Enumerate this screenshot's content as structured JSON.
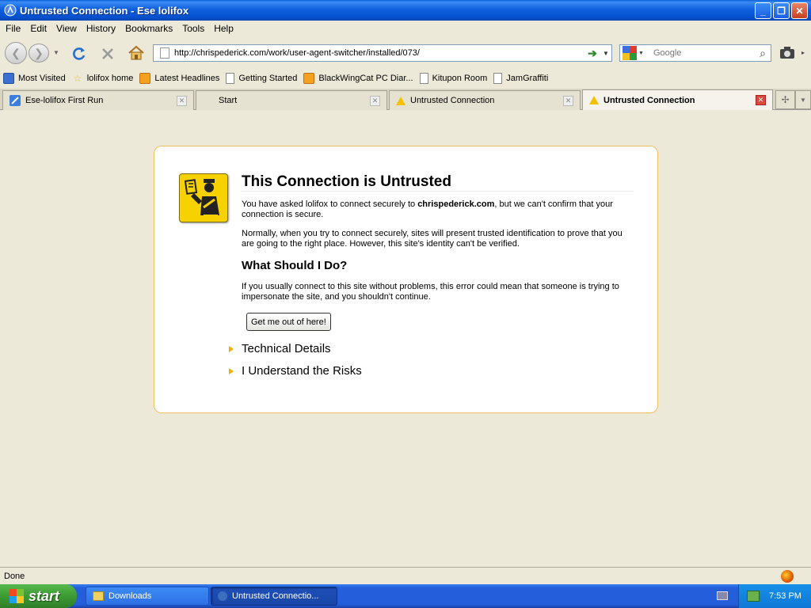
{
  "window": {
    "title": "Untrusted Connection - Ese lolifox",
    "min_symbol": "_",
    "max_symbol": "❐",
    "close_symbol": "✕"
  },
  "menu": [
    "File",
    "Edit",
    "View",
    "History",
    "Bookmarks",
    "Tools",
    "Help"
  ],
  "navbar": {
    "url": "http://chrispederick.com/work/user-agent-switcher/installed/073/",
    "search_placeholder": "Google",
    "icons": [
      "back-icon",
      "forward-icon",
      "reload-icon",
      "stop-icon",
      "home-icon",
      "go-icon",
      "search-icon",
      "camera-icon"
    ]
  },
  "bookmarks": [
    {
      "label": "Most Visited",
      "icon": "most-visited-icon"
    },
    {
      "label": "lolifox home",
      "icon": "star-icon"
    },
    {
      "label": "Latest Headlines",
      "icon": "rss-icon"
    },
    {
      "label": "Getting Started",
      "icon": "page-icon"
    },
    {
      "label": "BlackWingCat PC Diar...",
      "icon": "rss-icon"
    },
    {
      "label": "Kitupon Room",
      "icon": "page-icon"
    },
    {
      "label": "JamGraffiti",
      "icon": "page-icon"
    }
  ],
  "tabs": [
    {
      "label": "Ese-lolifox First Run",
      "active": false
    },
    {
      "label": "Start",
      "active": false
    },
    {
      "label": "Untrusted Connection",
      "active": false
    },
    {
      "label": "Untrusted Connection",
      "active": true
    }
  ],
  "error": {
    "title": "This Connection is Untrusted",
    "p1_pre": "You have asked lolifox to connect securely to ",
    "p1_domain": "chrispederick.com",
    "p1_post": ", but we can't confirm that your connection is secure.",
    "p2": "Normally, when you try to connect securely, sites will present trusted identification to prove that you are going to the right place. However, this site's identity can't be verified.",
    "h2": "What Should I Do?",
    "p3": "If you usually connect to this site without problems, this error could mean that someone is trying to impersonate the site, and you shouldn't continue.",
    "button": "Get me out of here!",
    "technical": "Technical Details",
    "risks": "I Understand the Risks"
  },
  "status": {
    "text": "Done"
  },
  "taskbar": {
    "start": "start",
    "tasks": [
      "Downloads",
      "Untrusted Connectio..."
    ],
    "clock": "7:53 PM"
  },
  "colors": {
    "accent_titlebar": "#0553d0",
    "warning_yellow": "#f7d200",
    "box_border": "#f0c060",
    "start_green": "#3c9b34"
  }
}
